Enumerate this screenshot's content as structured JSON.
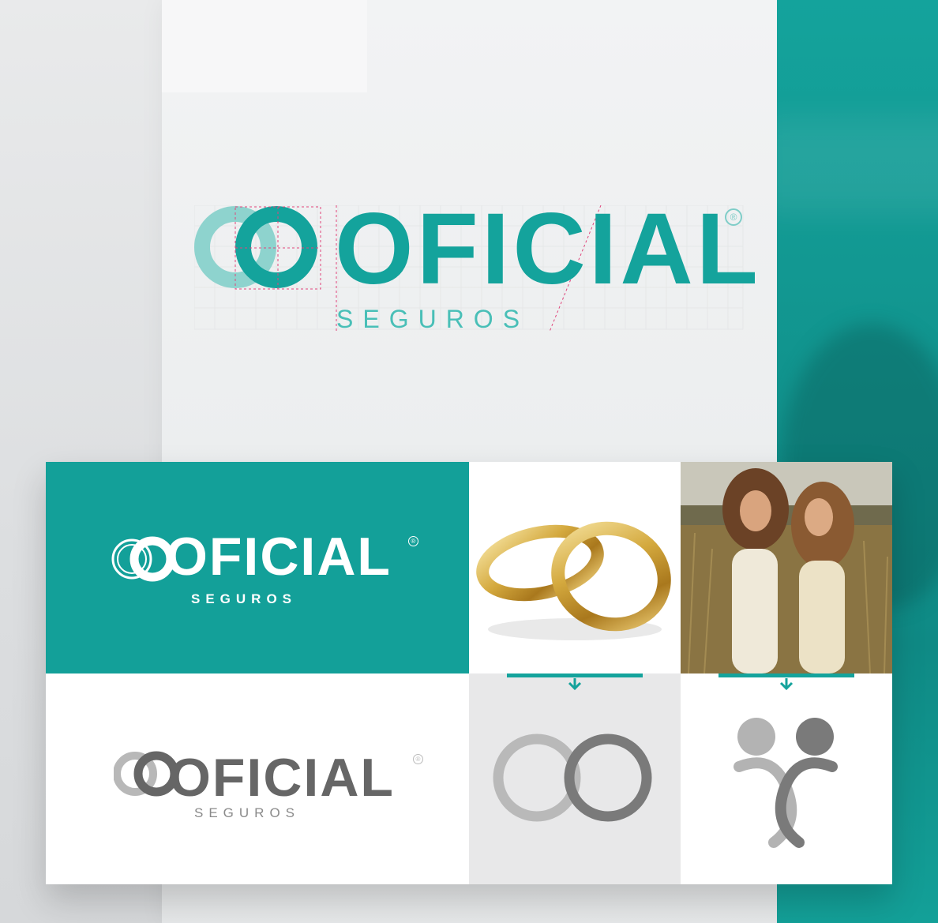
{
  "brand": {
    "name": "OFICIAL",
    "subtitle": "SEGUROS",
    "registered_mark": "®",
    "colors": {
      "teal": "#14a39c",
      "teal_light": "#7fcdc8",
      "gray_dark": "#666666",
      "gray_light": "#b5b5b5",
      "guide_magenta": "#e0457b"
    }
  },
  "construction": {
    "name": "OFICIAL",
    "subtitle": "SEGUROS",
    "registered_mark": "®"
  },
  "panels": {
    "teal_logo": {
      "name": "OFICIAL",
      "subtitle": "SEGUROS",
      "registered_mark": "®"
    },
    "gray_logo": {
      "name": "OFICIAL",
      "subtitle": "SEGUROS",
      "registered_mark": "®"
    },
    "rings_photo": {
      "icon": "wedding-rings-photo"
    },
    "people_photo": {
      "icon": "two-women-field-photo"
    },
    "rings_symbol": {
      "icon": "interlocked-rings-icon"
    },
    "people_symbol": {
      "icon": "two-people-embrace-icon"
    }
  }
}
